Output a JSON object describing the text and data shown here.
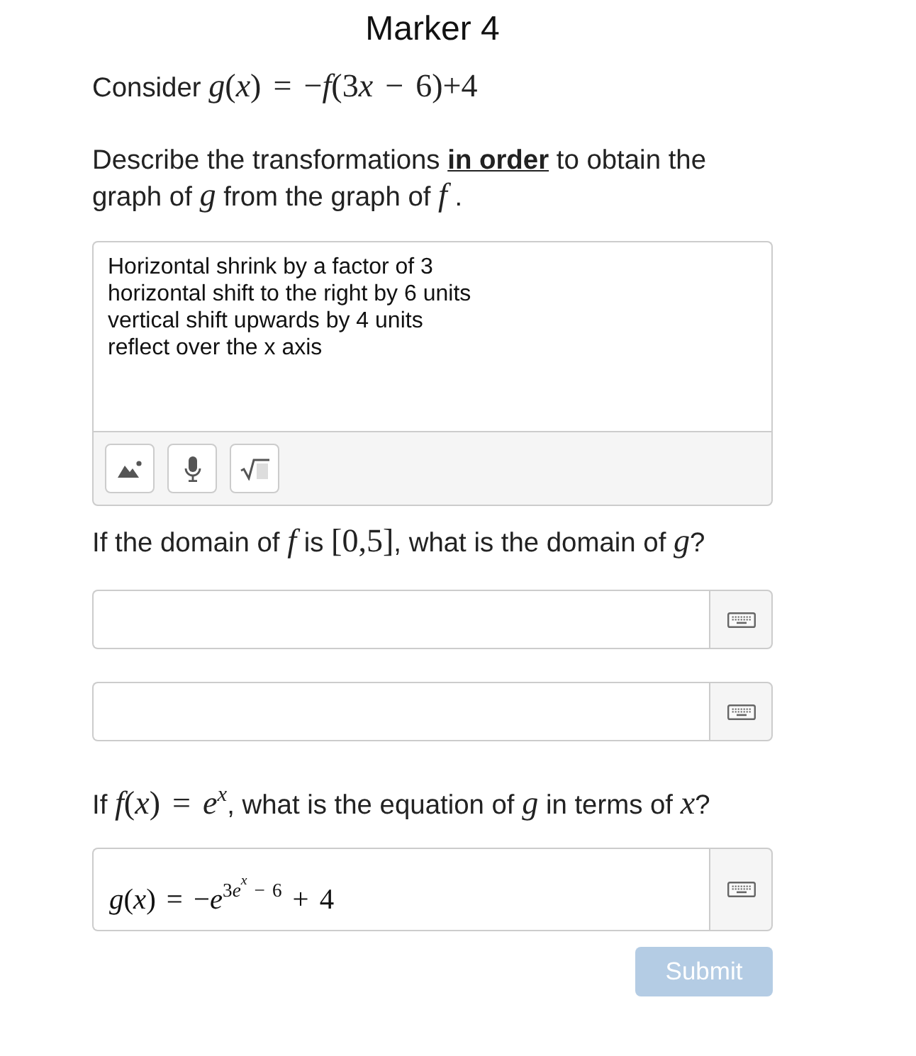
{
  "title": "Marker 4",
  "intro": [
    {
      "kind": "text",
      "text": "Consider "
    },
    {
      "kind": "math",
      "text": "*g*(*x*) = −*f*(3"
    },
    {
      "kind": "math",
      "text": "*x*"
    },
    {
      "kind": "math",
      "text": " − 6)+4"
    }
  ],
  "transformations": {
    "prompt": [
      {
        "kind": "text",
        "text": "Describe the transformations **in order** to obtain the graph of "
      },
      {
        "kind": "math",
        "text": "*g*"
      },
      {
        "kind": "text",
        "text": " from the graph of "
      },
      {
        "kind": "math",
        "text": "*f*"
      },
      {
        "kind": "text",
        "text": " ."
      }
    ],
    "response": {
      "value": "Horizontal shrink by a factor of 3\nhorizontal shift to the right by 6 units\nvertical shift upwards by 4 units\nreflect over the x axis",
      "tools": [
        {
          "kind": "image"
        },
        {
          "kind": "microphone"
        },
        {
          "kind": "math"
        }
      ]
    }
  },
  "domain": {
    "prompt": [
      {
        "kind": "text",
        "text": "If the domain of "
      },
      {
        "kind": "math",
        "text": "*f*"
      },
      {
        "kind": "text",
        "text": " is "
      },
      {
        "kind": "math",
        "text": "[0,5]"
      },
      {
        "kind": "text",
        "text": ", what is the domain of "
      },
      {
        "kind": "math",
        "text": "*g*"
      },
      {
        "kind": "text",
        "text": "?"
      }
    ],
    "answers": [
      {
        "keyboard": true
      },
      {
        "keyboard": true
      }
    ]
  },
  "equation": {
    "prompt": [
      {
        "kind": "text",
        "text": "If "
      },
      {
        "kind": "math",
        "text": "*f*(*x*) = *e*"
      },
      {
        "kind": "math-raised",
        "text": "*x*"
      },
      {
        "kind": "text",
        "text": ", what is the equation of "
      },
      {
        "kind": "math",
        "text": "*g*"
      },
      {
        "kind": "text",
        "text": " in terms of "
      },
      {
        "kind": "math",
        "text": "*x*"
      },
      {
        "kind": "text",
        "text": "?"
      }
    ],
    "answer": {
      "value": [
        {
          "kind": "math",
          "text": "*g*(*x*) = −*e*"
        },
        {
          "kind": "math-raised",
          "text": "3"
        },
        {
          "kind": "math-raised",
          "text": "*e*"
        },
        {
          "kind": "math-raised-twice",
          "text": "*x*"
        },
        {
          "kind": "math-raised",
          "text": " − 6"
        },
        {
          "kind": "math",
          "text": " + 4"
        }
      ],
      "keyboard": true
    }
  },
  "submit": {
    "label": "Submit",
    "disabled": true
  }
}
